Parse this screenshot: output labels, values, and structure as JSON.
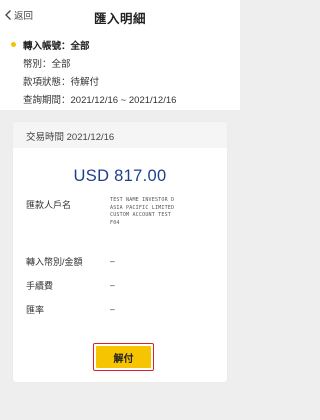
{
  "nav": {
    "back_label": "返回",
    "title": "匯入明細"
  },
  "filter": {
    "account": "轉入帳號：全部",
    "currency": "幣別：全部",
    "status": "款項狀態：待解付",
    "period": "查詢期間：2021/12/16 ~ 2021/12/16"
  },
  "card": {
    "time": "交易時間 2021/12/16",
    "amount": "USD 817.00",
    "payee_label": "匯款人戶名",
    "payee_lines": [
      "TEST NAME INVESTOR D",
      "ASIA PACIFIC LIMITED",
      "CUSTOM ACCOUNT TEST",
      "F04"
    ],
    "inflow_label": "轉入幣別/金額",
    "inflow_value": "–",
    "fee_label": "手續費",
    "fee_value": "–",
    "rate_label": "匯率",
    "rate_value": "–",
    "action_label": "解付"
  },
  "colors": {
    "accent_yellow": "#f6c400",
    "amount_blue": "#1f3f8f",
    "highlight_red": "#e02020"
  }
}
